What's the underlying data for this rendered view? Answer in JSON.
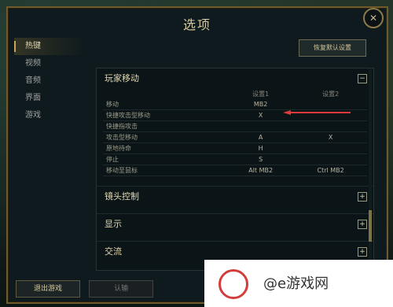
{
  "window": {
    "title": "选项",
    "close_icon": "close-icon"
  },
  "sidebar": {
    "items": [
      {
        "label": "热键"
      },
      {
        "label": "视频"
      },
      {
        "label": "音频"
      },
      {
        "label": "界面"
      },
      {
        "label": "游戏"
      }
    ]
  },
  "toolbar": {
    "restore_label": "恢复默认设置"
  },
  "hotkeys": {
    "section_title": "玩家移动",
    "col1": "设置1",
    "col2": "设置2",
    "rows": [
      {
        "label": "移动",
        "k1": "MB2",
        "k2": ""
      },
      {
        "label": "快捷攻击型移动",
        "k1": "X",
        "k2": ""
      },
      {
        "label": "快捷指攻击",
        "k1": "",
        "k2": ""
      },
      {
        "label": "攻击型移动",
        "k1": "A",
        "k2": "X"
      },
      {
        "label": "原地待命",
        "k1": "H",
        "k2": ""
      },
      {
        "label": "停止",
        "k1": "S",
        "k2": ""
      },
      {
        "label": "移动至鼠标",
        "k1": "Alt MB2",
        "k2": "Ctrl MB2"
      }
    ]
  },
  "sections": [
    {
      "label": "镜头控制"
    },
    {
      "label": "显示"
    },
    {
      "label": "交流"
    }
  ],
  "footer": {
    "exit_label": "退出游戏",
    "confirm_label": "认输"
  },
  "overlay": {
    "site_text": "@e游戏网"
  }
}
